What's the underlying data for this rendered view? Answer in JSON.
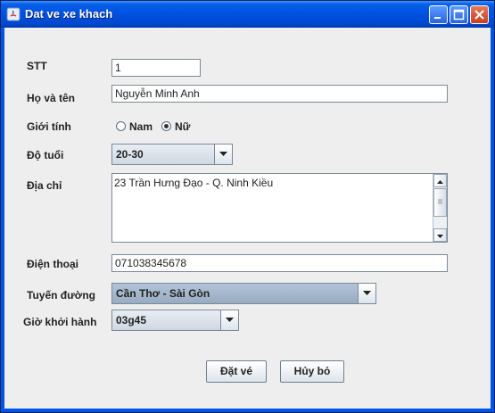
{
  "window": {
    "title": "Dat ve xe khach"
  },
  "form": {
    "stt_label": "STT",
    "stt_value": "1",
    "name_label": "Họ và tên",
    "name_value": "Nguyễn Minh Anh",
    "gender_label": "Giới tính",
    "gender_options": [
      "Nam",
      "Nữ"
    ],
    "gender_selected": "Nữ",
    "age_label": "Độ tuổi",
    "age_value": "20-30",
    "address_label": "Địa chỉ",
    "address_value": "23 Trần Hưng Đạo - Q. Ninh Kiều",
    "phone_label": "Điện thoại",
    "phone_value": "071038345678",
    "route_label": "Tuyến đường",
    "route_value": "Cần Thơ - Sài Gòn",
    "depart_label": "Giờ khởi hành",
    "depart_value": "03g45"
  },
  "buttons": {
    "book": "Đặt vé",
    "cancel": "Hủy bỏ"
  },
  "colors": {
    "titlebar": "#0054e3",
    "route_combo_bg": "#a3b6cc",
    "client_bg": "#eeeeee"
  }
}
